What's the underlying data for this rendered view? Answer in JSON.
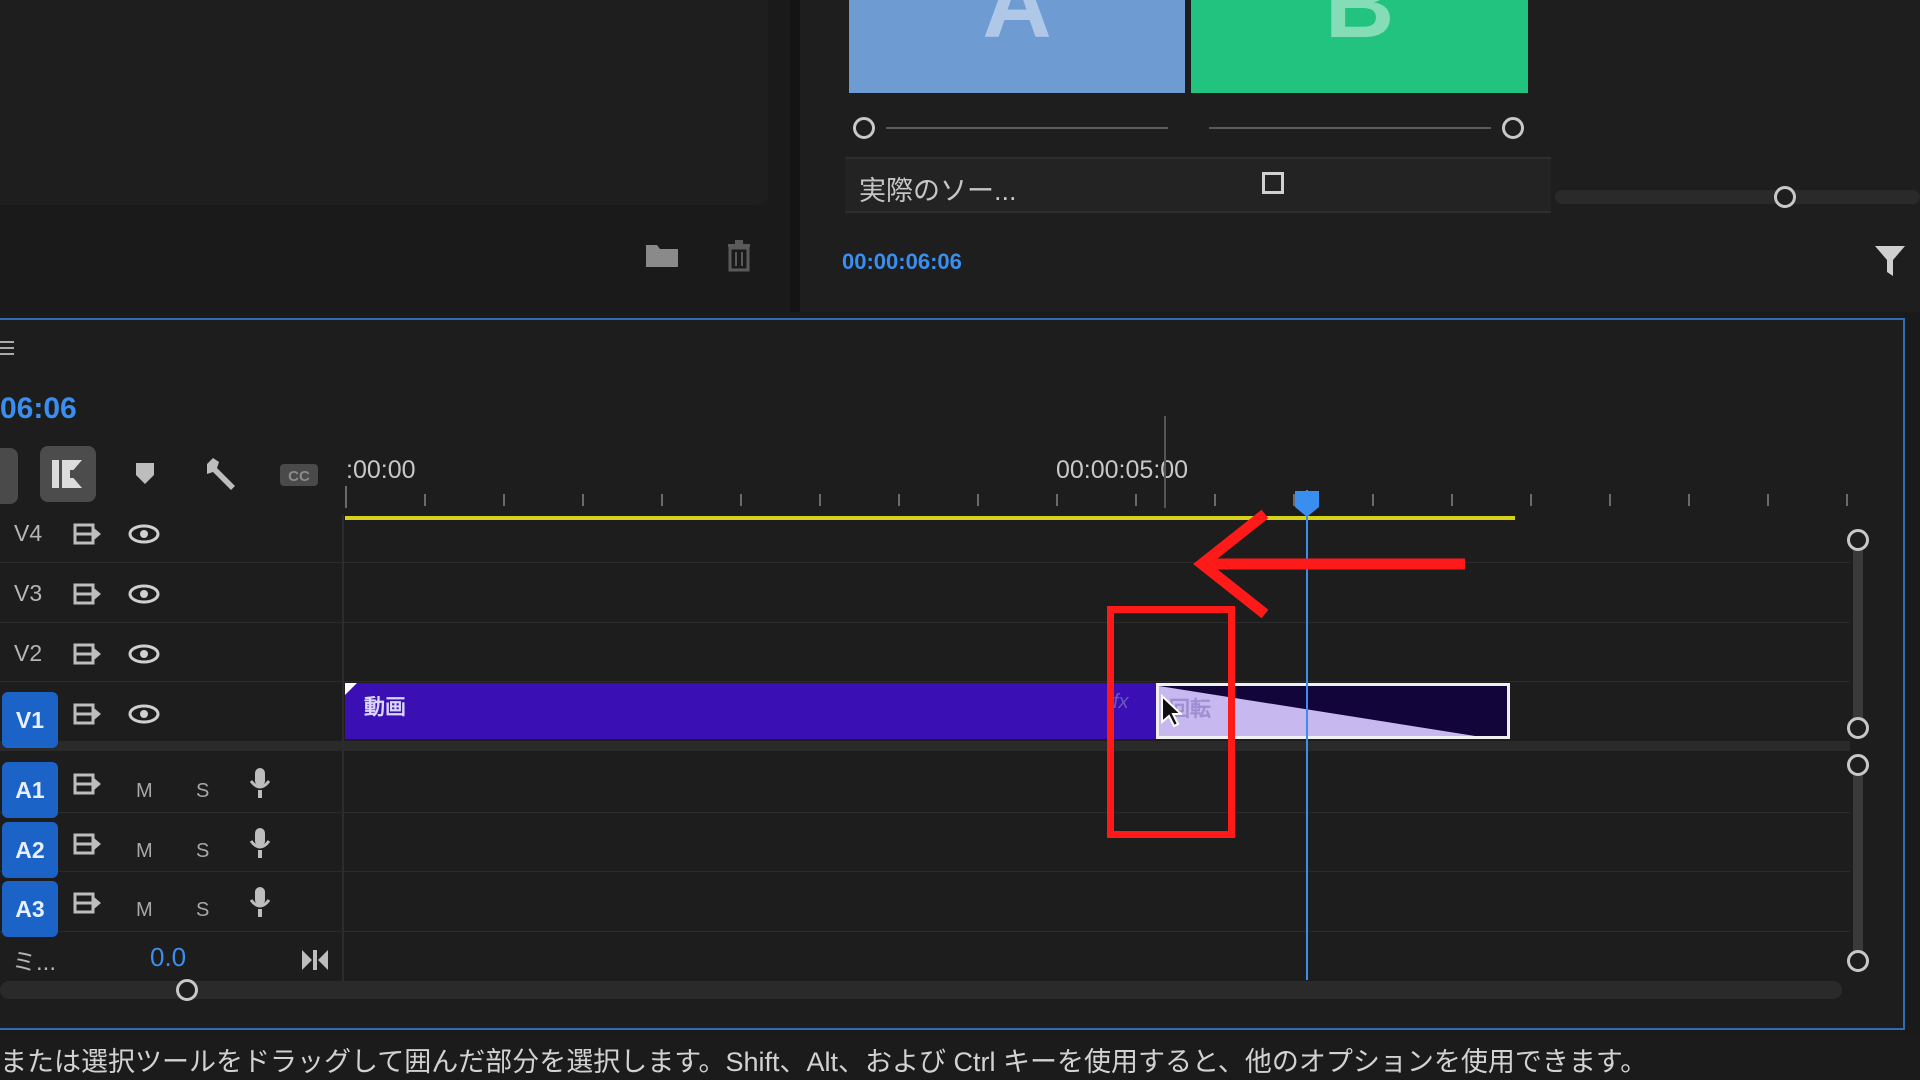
{
  "effect_panel": {
    "swatch_a_letter": "A",
    "swatch_b_letter": "B",
    "swatch_a_color": "#6f9bd3",
    "swatch_b_color": "#22c27f",
    "property_label": "実際のソー...",
    "timecode": "00:00:06:06"
  },
  "timeline": {
    "current_time": "06:06",
    "ruler_start": ":00:00",
    "ruler_mid": "00:00:05:00",
    "video_tracks": [
      {
        "id": "V4"
      },
      {
        "id": "V3"
      },
      {
        "id": "V2"
      },
      {
        "id": "V1"
      }
    ],
    "audio_tracks": [
      {
        "id": "A1",
        "mute": "M",
        "solo": "S"
      },
      {
        "id": "A2",
        "mute": "M",
        "solo": "S"
      },
      {
        "id": "A3",
        "mute": "M",
        "solo": "S"
      }
    ],
    "mix_label": "ミ...",
    "mix_value": "0.0",
    "clip_main_label": "動画",
    "clip_transition_label": "回転",
    "fx_label": "fx"
  },
  "status_bar": {
    "message": "または選択ツールをドラッグして囲んだ部分を選択します。Shift、Alt、および Ctrl キーを使用すると、他のオプションを使用できます。"
  },
  "colors": {
    "accent_blue": "#1b63c7",
    "timecode_blue": "#3a8ef0",
    "clip_purple": "#3a0fb4",
    "work_area_yellow": "#d6d21c",
    "annotation_red": "#ff1a1a"
  },
  "icons": [
    "folder-icon",
    "trash-icon",
    "filter-icon",
    "menu-icon",
    "snap-icon",
    "linked-selection-icon",
    "marker-icon",
    "wrench-icon",
    "captions-icon",
    "track-output-icon",
    "eye-icon",
    "microphone-icon",
    "zoom-fit-icon",
    "mouse-cursor-icon",
    "annotation-arrow",
    "annotation-box"
  ]
}
